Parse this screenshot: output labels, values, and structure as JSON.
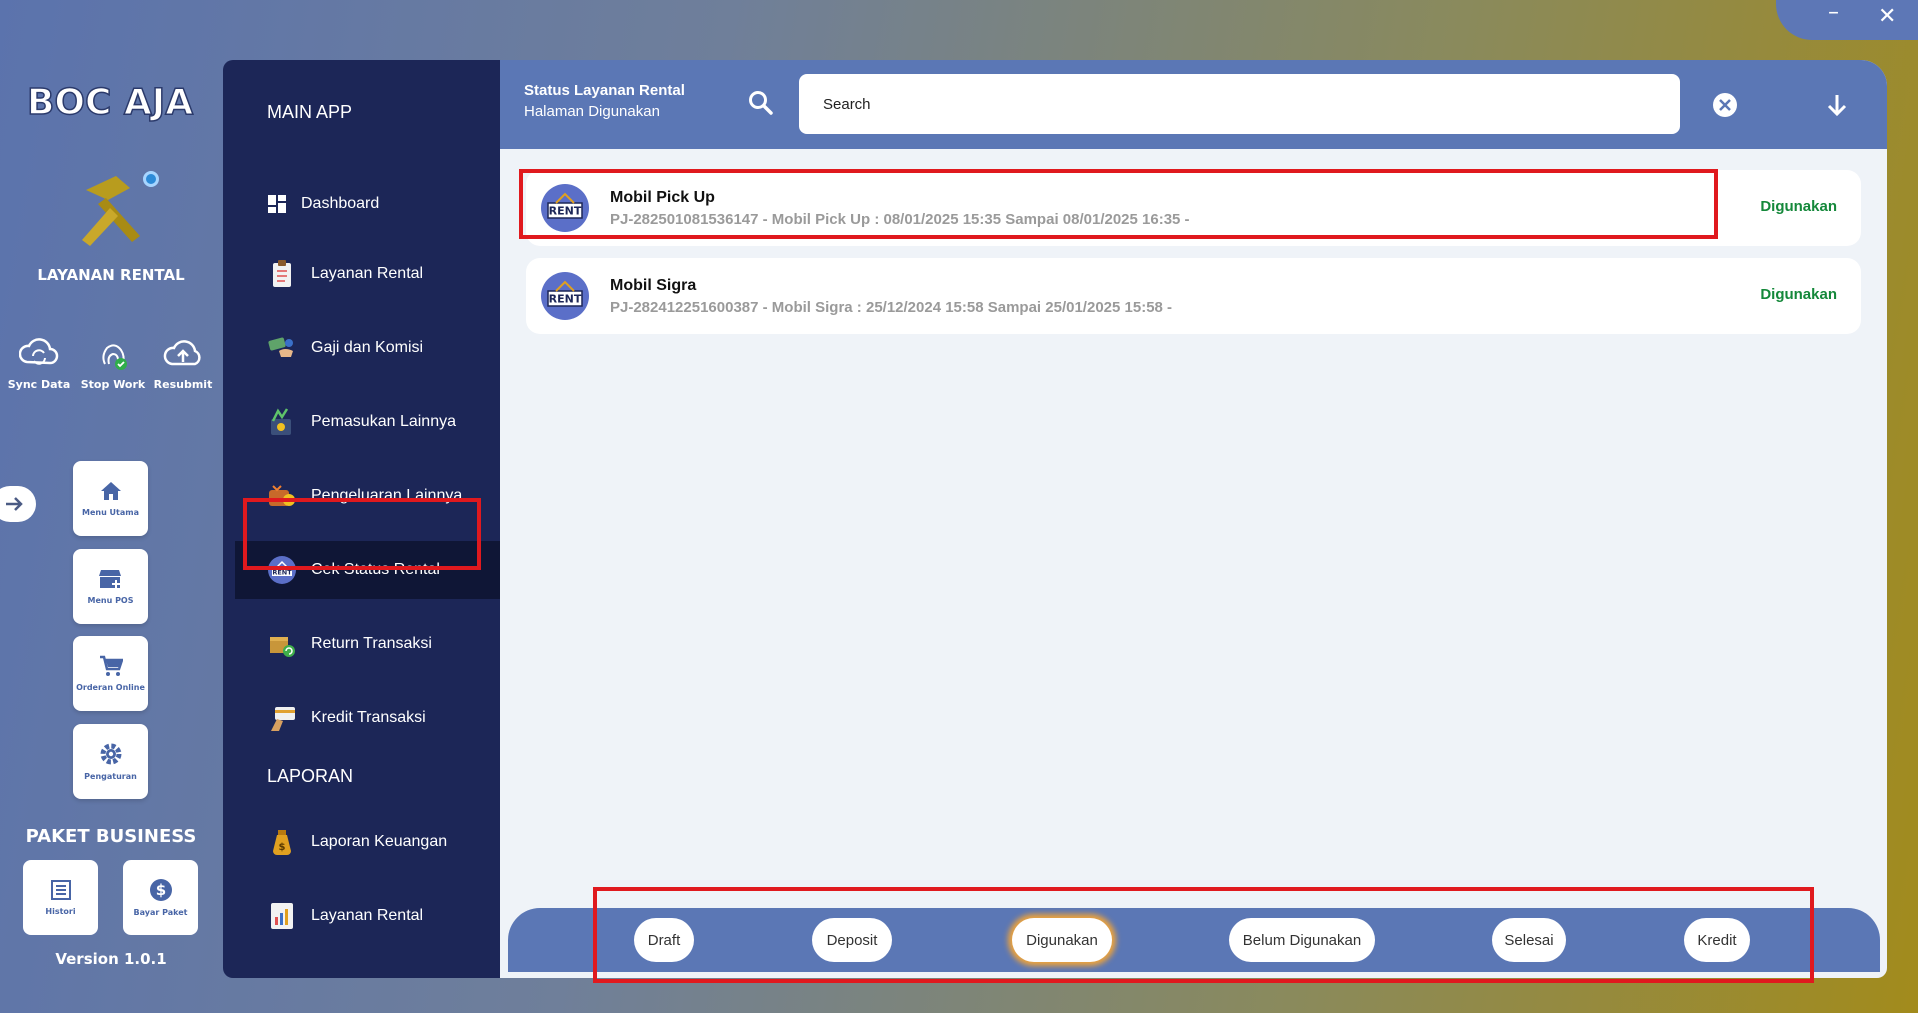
{
  "window": {
    "minimize_label": "–",
    "close_label": "✕"
  },
  "rail": {
    "logo_text": "BOC AJA",
    "app_name": "LAYANAN RENTAL",
    "quick_actions": [
      {
        "label": "Sync Data",
        "icon": "sync-icon"
      },
      {
        "label": "Stop Work",
        "icon": "fingerprint-icon"
      },
      {
        "label": "Resubmit",
        "icon": "cloud-upload-icon"
      }
    ],
    "tiles": [
      {
        "label": "Menu Utama",
        "icon": "home-icon"
      },
      {
        "label": "Menu POS",
        "icon": "store-icon"
      },
      {
        "label": "Orderan Online",
        "icon": "cart-icon"
      },
      {
        "label": "Pengaturan",
        "icon": "gear-icon"
      }
    ],
    "package_title": "PAKET BUSINESS",
    "package_tiles": [
      {
        "label": "Histori",
        "icon": "list-icon"
      },
      {
        "label": "Bayar Paket",
        "icon": "dollar-icon"
      }
    ],
    "version": "Version 1.0.1"
  },
  "sidebar": {
    "section_main": "MAIN APP",
    "main_items": [
      {
        "label": "Dashboard",
        "icon": "dashboard-icon"
      },
      {
        "label": "Layanan Rental",
        "icon": "clipboard-icon"
      },
      {
        "label": "Gaji dan Komisi",
        "icon": "money-hand-icon"
      },
      {
        "label": "Pemasukan Lainnya",
        "icon": "income-icon"
      },
      {
        "label": "Pengeluaran Lainnya",
        "icon": "expense-icon"
      },
      {
        "label": "Cek Status Rental",
        "icon": "rent-icon"
      },
      {
        "label": "Return Transaksi",
        "icon": "return-box-icon"
      },
      {
        "label": "Kredit Transaksi",
        "icon": "credit-card-icon"
      }
    ],
    "section_report": "LAPORAN",
    "report_items": [
      {
        "label": "Laporan Keuangan",
        "icon": "money-bag-icon"
      },
      {
        "label": "Layanan Rental",
        "icon": "report-icon"
      }
    ]
  },
  "header": {
    "title": "Status Layanan Rental",
    "subtitle": "Halaman Digunakan",
    "search_placeholder": "Search"
  },
  "rentals": [
    {
      "title": "Mobil Pick Up",
      "description": "PJ-282501081536147 - Mobil Pick Up : 08/01/2025 15:35 Sampai 08/01/2025 16:35 -",
      "status": "Digunakan"
    },
    {
      "title": "Mobil Sigra",
      "description": "PJ-282412251600387 - Mobil Sigra : 25/12/2024 15:58 Sampai 25/01/2025 15:58 -",
      "status": "Digunakan"
    }
  ],
  "rent_badge": "RENT",
  "tabs": [
    {
      "label": "Draft"
    },
    {
      "label": "Deposit"
    },
    {
      "label": "Digunakan",
      "active": true
    },
    {
      "label": "Belum Digunakan"
    },
    {
      "label": "Selesai"
    },
    {
      "label": "Kredit"
    }
  ],
  "colors": {
    "accent": "#5b77b5",
    "sidebar": "#1c2657",
    "status_green": "#14883a",
    "highlight_red": "#e0191e",
    "active_tab_glow": "#f0a43a"
  }
}
